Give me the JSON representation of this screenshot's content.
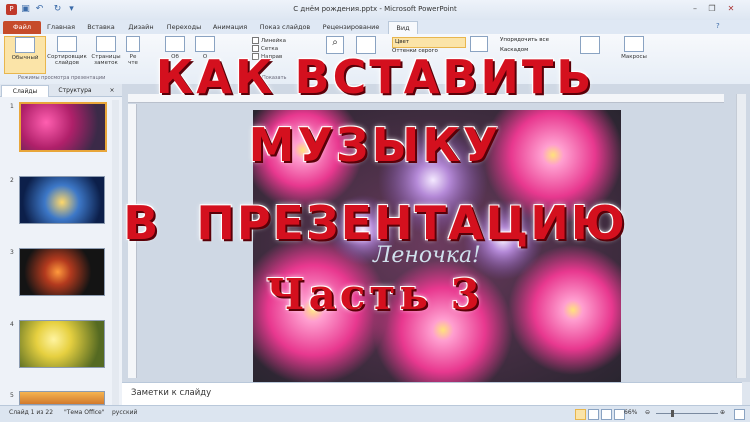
{
  "window": {
    "title": "С днём рождения.pptx - Microsoft PowerPoint",
    "controls": [
      "minimize-icon",
      "maximize-icon",
      "close-icon"
    ]
  },
  "ribbon": {
    "tabs": [
      "Файл",
      "Главная",
      "Вставка",
      "Дизайн",
      "Переходы",
      "Анимация",
      "Показ слайдов",
      "Рецензирование",
      "Вид"
    ],
    "active_tab": "Вид",
    "buttons": [
      {
        "label": "Обычный",
        "selected": true
      },
      {
        "label": "Сортировщик слайдов"
      },
      {
        "label": "Страницы заметок"
      },
      {
        "label": "Ре чте"
      },
      {
        "label": "Об"
      },
      {
        "label": "О"
      }
    ],
    "group_views_label": "Режимы просмотра презентации",
    "checkboxes": [
      "Линейка",
      "Сетка",
      "Направ"
    ],
    "show_group_label": "Показать",
    "color_items": [
      "Цвет",
      "Оттенки серого"
    ],
    "window_items": [
      "Упорядочить все",
      "Каскадом"
    ],
    "macros_label": "Макросы"
  },
  "left_pane": {
    "tabs": [
      "Слайды",
      "Структура"
    ],
    "close_label": "×",
    "slides": [
      {
        "num": "1",
        "theme": "pink-asters",
        "selected": true
      },
      {
        "num": "2",
        "theme": "fireworks-blue"
      },
      {
        "num": "3",
        "theme": "fireworks-dark"
      },
      {
        "num": "4",
        "theme": "yellow-daisies"
      },
      {
        "num": "5",
        "theme": "orange"
      }
    ]
  },
  "slide": {
    "script_text": "Леночка!"
  },
  "overlay": {
    "line1": "КАК ВСТАВИТЬ",
    "line2": "МУЗЫКУ",
    "line3": "В  ПРЕЗЕНТАЦИЮ",
    "line4": "Часть 3",
    "color": "#d4101e"
  },
  "notes": {
    "placeholder": "Заметки к слайду"
  },
  "status": {
    "slide_info": "Слайд 1 из 22",
    "theme": "\"Тема Office\"",
    "language": "русский",
    "zoom": "66%"
  }
}
